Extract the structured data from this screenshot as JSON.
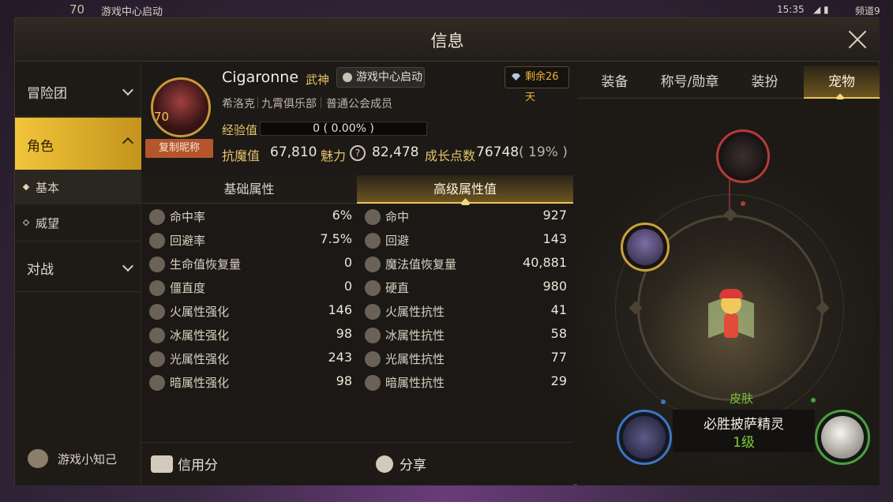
{
  "statusbar": {
    "level": "70",
    "game_center": "游戏中心启动",
    "time": "15:35",
    "channel": "频道9"
  },
  "window": {
    "title": "信息"
  },
  "sidebar": {
    "adventure_group": "冒险团",
    "character": "角色",
    "basic": "基本",
    "prestige": "威望",
    "battle": "对战",
    "tips": "游戏小知己"
  },
  "profile": {
    "level": "70",
    "name": "Cigaronne",
    "class": "武神",
    "game_center_button": "游戏中心启动",
    "remaining": "剩余26天",
    "server": "希洛克",
    "club": "九霄俱乐部",
    "guild_role": "普通公会成员",
    "copy_nickname": "复制昵称",
    "exp_label": "经验值",
    "exp_value": "0 ( 0.00% )",
    "resist_label": "抗魔值",
    "resist_value": "67,810",
    "charm_label": "魅力",
    "charm_value": "82,478",
    "growth_label": "成长点数",
    "growth_value": "76748",
    "growth_pct": "( 19% )"
  },
  "attr_tabs": {
    "basic": "基础属性",
    "advanced": "高级属性值"
  },
  "attributes": {
    "left": [
      {
        "name": "命中率",
        "value": "6%",
        "icon": "target-icon"
      },
      {
        "name": "回避率",
        "value": "7.5%",
        "icon": "dodge-icon"
      },
      {
        "name": "生命值恢复量",
        "value": "0",
        "icon": "heart-icon"
      },
      {
        "name": "僵直度",
        "value": "0",
        "icon": "stun-icon"
      },
      {
        "name": "火属性强化",
        "value": "146",
        "icon": "fire-icon"
      },
      {
        "name": "冰属性强化",
        "value": "98",
        "icon": "ice-icon"
      },
      {
        "name": "光属性强化",
        "value": "243",
        "icon": "light-icon"
      },
      {
        "name": "暗属性强化",
        "value": "98",
        "icon": "dark-icon"
      }
    ],
    "right": [
      {
        "name": "命中",
        "value": "927",
        "icon": "target-icon"
      },
      {
        "name": "回避",
        "value": "143",
        "icon": "dodge-icon"
      },
      {
        "name": "魔法值恢复量",
        "value": "40,881",
        "icon": "mana-icon"
      },
      {
        "name": "硬直",
        "value": "980",
        "icon": "stagger-icon"
      },
      {
        "name": "火属性抗性",
        "value": "41",
        "icon": "fire-icon"
      },
      {
        "name": "冰属性抗性",
        "value": "58",
        "icon": "ice-icon"
      },
      {
        "name": "光属性抗性",
        "value": "77",
        "icon": "light-icon"
      },
      {
        "name": "暗属性抗性",
        "value": "29",
        "icon": "moon-icon"
      }
    ]
  },
  "bottom": {
    "credit": "信用分",
    "share": "分享"
  },
  "right_tabs": [
    "装备",
    "称号/勋章",
    "装扮",
    "宠物"
  ],
  "pet": {
    "skin": "皮肤",
    "name": "必胜披萨精灵",
    "level": "1级"
  },
  "colors": {
    "accent_gold": "#e8c45a",
    "exp_label": "#e3c46a",
    "pet_level_green": "#7ccf3a",
    "copy_button": "#b4552b",
    "diamond_text": "#f2b23a"
  }
}
